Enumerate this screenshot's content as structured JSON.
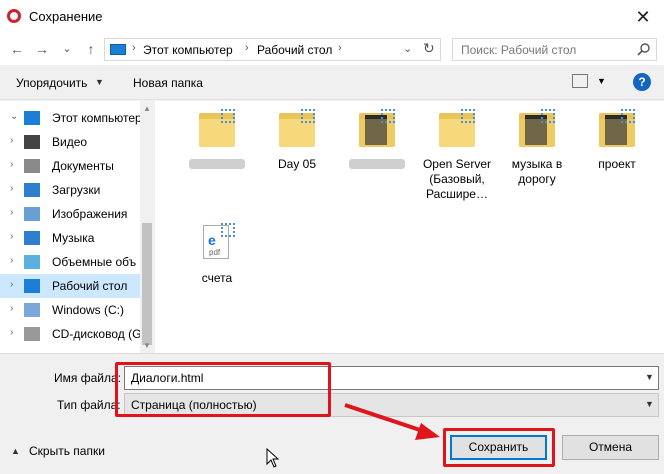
{
  "window": {
    "title": "Сохранение",
    "close": "✕"
  },
  "nav": {
    "back": "←",
    "forward": "→",
    "recent": "⌄",
    "up": "↑",
    "breadcrumb": [
      "Этот компьютер",
      "Рабочий стол"
    ],
    "search_placeholder": "Поиск: Рабочий стол"
  },
  "toolbar": {
    "organize": "Упорядочить",
    "new_folder": "Новая папка",
    "help": "?"
  },
  "sidebar": {
    "items": [
      {
        "label": "Этот компьютер",
        "icon": "computer-icon"
      },
      {
        "label": "Видео",
        "icon": "video-icon"
      },
      {
        "label": "Документы",
        "icon": "documents-icon"
      },
      {
        "label": "Загрузки",
        "icon": "downloads-icon"
      },
      {
        "label": "Изображения",
        "icon": "pictures-icon"
      },
      {
        "label": "Музыка",
        "icon": "music-icon"
      },
      {
        "label": "Объемные объ",
        "icon": "3d-objects-icon"
      },
      {
        "label": "Рабочий стол",
        "icon": "desktop-icon",
        "selected": true
      },
      {
        "label": "Windows (C:)",
        "icon": "drive-icon"
      },
      {
        "label": "CD-дисковод (G",
        "icon": "cd-drive-icon"
      }
    ]
  },
  "files": [
    {
      "label": "",
      "type": "folder-shortcut-blurred"
    },
    {
      "label": "Day 05",
      "type": "folder-shortcut"
    },
    {
      "label": "",
      "type": "folder-image-blurred"
    },
    {
      "label": "Open Server (Базовый, Расшире…",
      "type": "folder-shortcut"
    },
    {
      "label": "музыка в дорогу",
      "type": "folder-image"
    },
    {
      "label": "проект",
      "type": "folder-image"
    },
    {
      "label": "счета",
      "type": "pdf-shortcut"
    }
  ],
  "form": {
    "filename_label": "Имя файла:",
    "filename_value": "Диалоги.html",
    "filetype_label": "Тип файла:",
    "filetype_value": "Страница (полностью)"
  },
  "footer": {
    "hide_folders": "Скрыть папки",
    "save": "Сохранить",
    "cancel": "Отмена"
  },
  "colors": {
    "accent": "#0078d7",
    "highlight": "#e0151b",
    "selection": "#cce8ff"
  }
}
